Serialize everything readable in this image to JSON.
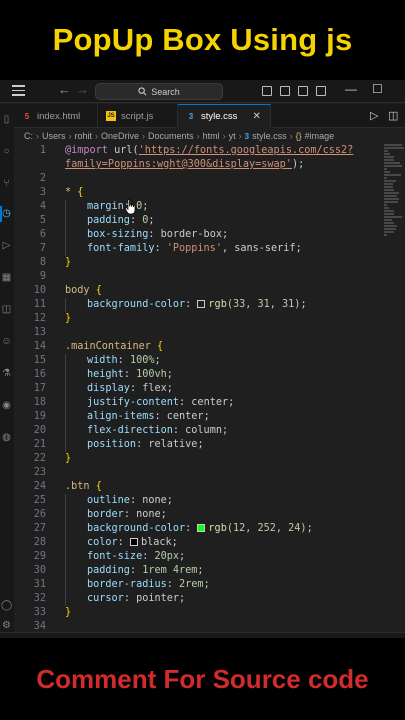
{
  "banner": {
    "title": "PopUp Box Using js",
    "footer": "Comment For Source code",
    "title_color": "#f5d300",
    "footer_color": "#d12b2b"
  },
  "titlebar": {
    "menu_icon": "hamburger-icon",
    "back_icon": "arrow-left-icon",
    "forward_icon": "arrow-right-icon",
    "search_label": "Search"
  },
  "tabs": [
    {
      "label": "index.html",
      "icon": "html-file-icon",
      "icon_glyph": "5",
      "icon_color": "#e44d26",
      "active": false
    },
    {
      "label": "script.js",
      "icon": "js-file-icon",
      "icon_glyph": "JS",
      "icon_color": "#f1c40f",
      "active": false
    },
    {
      "label": "style.css",
      "icon": "css-file-icon",
      "icon_glyph": "3",
      "icon_color": "#42a5f5",
      "active": true
    }
  ],
  "breadcrumb": {
    "items": [
      "C:",
      "Users",
      "rohit",
      "OneDrive",
      "Documents",
      "html",
      "yt"
    ],
    "file": "style.css",
    "symbol": "#image"
  },
  "code": {
    "lines": [
      "1",
      "2",
      "3",
      "4",
      "5",
      "6",
      "7",
      "8",
      "9",
      "10",
      "11",
      "12",
      "13",
      "14",
      "15",
      "16",
      "17",
      "18",
      "19",
      "20",
      "21",
      "22",
      "23",
      "24",
      "25",
      "26",
      "27",
      "28",
      "29",
      "30",
      "31",
      "32",
      "33",
      "34"
    ],
    "import_kw": "@import",
    "import_url_fn": "url(",
    "import_url_1": "'https://fonts.googleapis.com/css2?",
    "import_url_2": "family=Poppins:wght@300&display=swap'",
    "import_end": ");",
    "universal_sel": "*",
    "margin_prop": "margin",
    "margin_val": "0",
    "padding_prop": "padding",
    "padding_val": "0",
    "boxsizing_prop": "box-sizing",
    "boxsizing_val": "border-box",
    "fontfamily_prop": "font-family",
    "fontfamily_val1": "'Poppins'",
    "fontfamily_val2": "sans-serif",
    "body_sel": "body",
    "bg_prop": "background-color",
    "body_bg_fn": "rgb",
    "body_bg_args": "(33, 31, 31)",
    "body_bg_swatch": "#211f1f",
    "main_sel": ".mainContainer",
    "width_prop": "width",
    "width_val": "100%",
    "height_prop": "height",
    "height_val": "100vh",
    "display_prop": "display",
    "display_val": "flex",
    "jc_prop": "justify-content",
    "jc_val": "center",
    "ai_prop": "align-items",
    "ai_val": "center",
    "fd_prop": "flex-direction",
    "fd_val": "column",
    "pos_prop": "position",
    "pos_val": "relative",
    "btn_sel": ".btn",
    "outline_prop": "outline",
    "outline_val": "none",
    "border_prop": "border",
    "border_val": "none",
    "btn_bg_fn": "rgb",
    "btn_bg_args": "(12, 252, 24)",
    "btn_bg_swatch": "#0cfc18",
    "color_prop": "color",
    "color_val": "black",
    "color_swatch": "#000000",
    "fs_prop": "font-size",
    "fs_val": "20px",
    "pad2_prop": "padding",
    "pad2_val": "1rem 4rem",
    "br_prop": "border-radius",
    "br_val": "2rem",
    "cursor_prop": "cursor",
    "cursor_val": "pointer"
  }
}
